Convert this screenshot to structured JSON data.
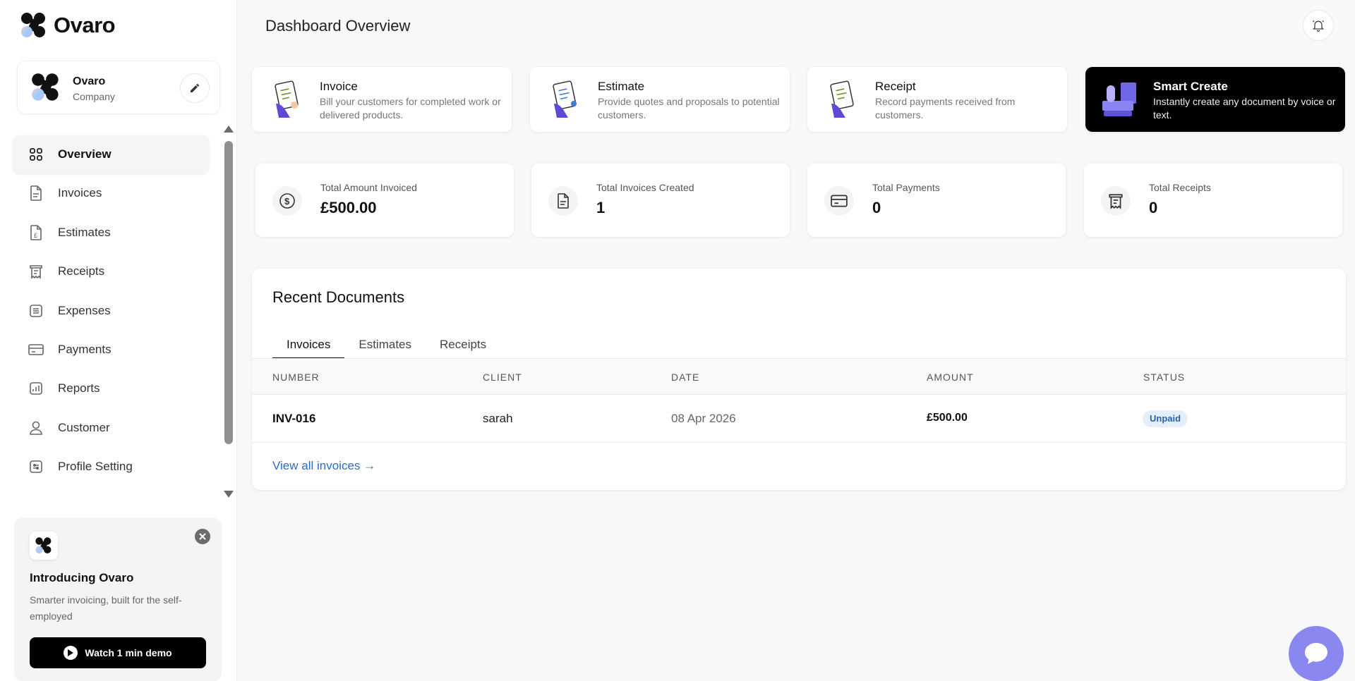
{
  "brand": {
    "name": "Ovaro"
  },
  "company": {
    "name": "Ovaro",
    "type": "Company"
  },
  "nav": [
    {
      "label": "Overview",
      "icon": "grid-icon",
      "active": true
    },
    {
      "label": "Invoices",
      "icon": "document-icon"
    },
    {
      "label": "Estimates",
      "icon": "estimate-icon"
    },
    {
      "label": "Receipts",
      "icon": "receipt-icon"
    },
    {
      "label": "Expenses",
      "icon": "list-icon"
    },
    {
      "label": "Payments",
      "icon": "card-icon"
    },
    {
      "label": "Reports",
      "icon": "chart-icon"
    },
    {
      "label": "Customer",
      "icon": "user-icon"
    },
    {
      "label": "Profile Setting",
      "icon": "settings-icon"
    }
  ],
  "promo": {
    "title": "Introducing Ovaro",
    "text": "Smarter invoicing, built for the self-employed",
    "button": "Watch 1 min demo"
  },
  "header": {
    "title": "Dashboard Overview"
  },
  "create_cards": [
    {
      "title": "Invoice",
      "desc": "Bill your customers for completed work or delivered products."
    },
    {
      "title": "Estimate",
      "desc": "Provide quotes and proposals to potential customers."
    },
    {
      "title": "Receipt",
      "desc": "Record payments received from customers."
    },
    {
      "title": "Smart Create",
      "desc": "Instantly create any document by voice or text."
    }
  ],
  "stats": [
    {
      "label": "Total Amount Invoiced",
      "value": "£500.00"
    },
    {
      "label": "Total Invoices Created",
      "value": "1"
    },
    {
      "label": "Total Payments",
      "value": "0"
    },
    {
      "label": "Total Receipts",
      "value": "0"
    }
  ],
  "recent": {
    "title": "Recent Documents",
    "tabs": [
      "Invoices",
      "Estimates",
      "Receipts"
    ],
    "columns": [
      "NUMBER",
      "CLIENT",
      "DATE",
      "AMOUNT",
      "STATUS"
    ],
    "rows": [
      {
        "number": "INV-016",
        "client": "sarah",
        "date": "08 Apr 2026",
        "amount": "£500.00",
        "status": "Unpaid"
      }
    ],
    "view_all": "View all invoices →"
  },
  "colors": {
    "accent": "#8b87f0",
    "status_unpaid_bg": "#e3f0fb",
    "link": "#2f6bc4"
  }
}
